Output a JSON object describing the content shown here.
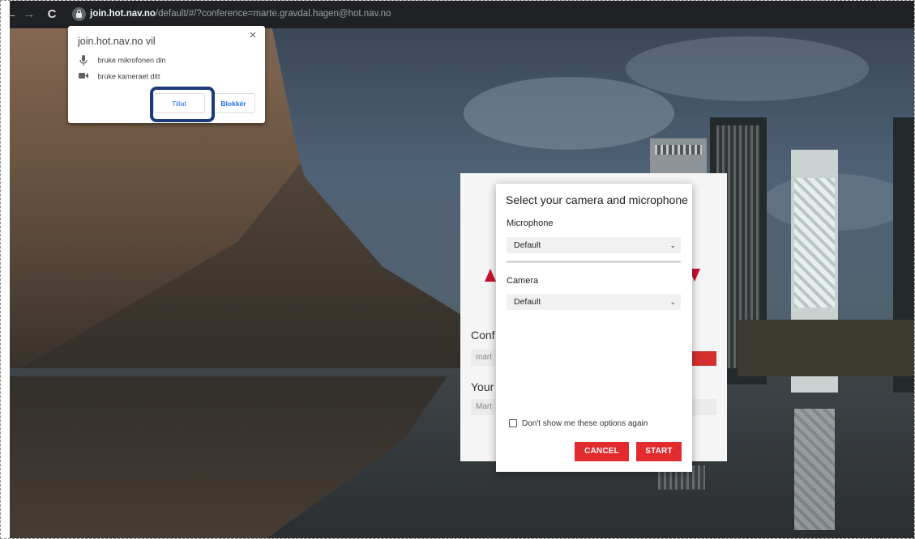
{
  "browser": {
    "url_host": "join.hot.nav.no",
    "url_path": "/default/#/?conference=marte.gravdal.hagen@hot.nav.no",
    "back_glyph": "←",
    "forward_glyph": "→",
    "reload_glyph": "C"
  },
  "permission_prompt": {
    "title": "join.hot.nav.no vil",
    "close_glyph": "×",
    "items": [
      {
        "icon": "microphone-icon",
        "label": "bruke mikrofonen din"
      },
      {
        "icon": "camera-icon",
        "label": "bruke kameraet ditt"
      }
    ],
    "allow_label": "Tillat",
    "block_label": "Blokkér",
    "highlight_color": "#1d3a7a"
  },
  "app_background": {
    "conference_label": "Conf",
    "conference_value": "mart",
    "name_label": "Your",
    "name_value": "Mart"
  },
  "device_dialog": {
    "title": "Select your camera and microphone",
    "microphone_label": "Microphone",
    "microphone_value": "Default",
    "camera_label": "Camera",
    "camera_value": "Default",
    "dont_show_label": "Don't show me these options again",
    "cancel_label": "CANCEL",
    "start_label": "START",
    "button_color": "#e22b2f"
  }
}
